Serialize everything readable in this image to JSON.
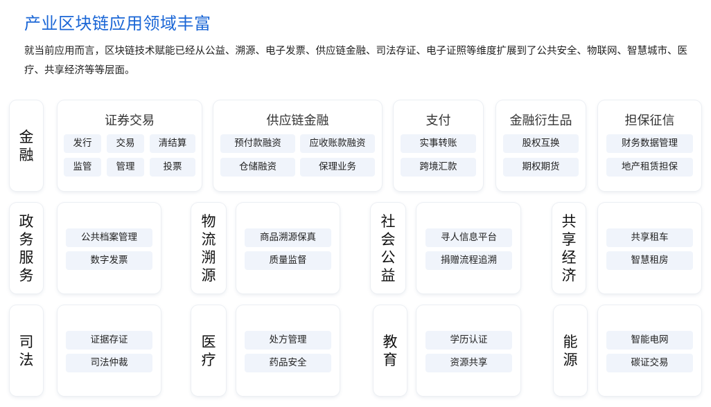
{
  "page": {
    "title": "产业区块链应用领域丰富",
    "description": "就当前应用而言，区块链技术赋能已经从公益、溯源、电子发票、供应链金融、司法存证、电子证照等维度扩展到了公共安全、物联网、智慧城市、医疗、共享经济等等层面。"
  },
  "rows": {
    "finance": {
      "label": "金融",
      "securities": {
        "title": "证券交易",
        "items": [
          "发行",
          "交易",
          "清结算",
          "监管",
          "管理",
          "投票"
        ]
      },
      "supply_chain": {
        "title": "供应链金融",
        "items": [
          "预付款融资",
          "应收账款融资",
          "仓储融资",
          "保理业务"
        ]
      },
      "payment": {
        "title": "支付",
        "items": [
          "实事转账",
          "跨境汇款"
        ]
      },
      "derivatives": {
        "title": "金融衍生品",
        "items": [
          "股权互换",
          "期权期货"
        ]
      },
      "guarantee": {
        "title": "担保征信",
        "items": [
          "财务数据管理",
          "地产租赁担保"
        ]
      }
    },
    "row2": [
      {
        "label": "政务服务",
        "items": [
          "公共档案管理",
          "数字发票"
        ]
      },
      {
        "label": "物流溯源",
        "items": [
          "商品溯源保真",
          "质量监督"
        ]
      },
      {
        "label": "社会公益",
        "items": [
          "寻人信息平台",
          "捐赠流程追溯"
        ]
      },
      {
        "label": "共享经济",
        "items": [
          "共享租车",
          "智慧租房"
        ]
      }
    ],
    "row3": [
      {
        "label": "司法",
        "items": [
          "证据存证",
          "司法仲裁"
        ]
      },
      {
        "label": "医疗",
        "items": [
          "处方管理",
          "药品安全"
        ]
      },
      {
        "label": "教育",
        "items": [
          "学历认证",
          "资源共享"
        ]
      },
      {
        "label": "能源",
        "items": [
          "智能电网",
          "碳证交易"
        ]
      }
    ]
  }
}
